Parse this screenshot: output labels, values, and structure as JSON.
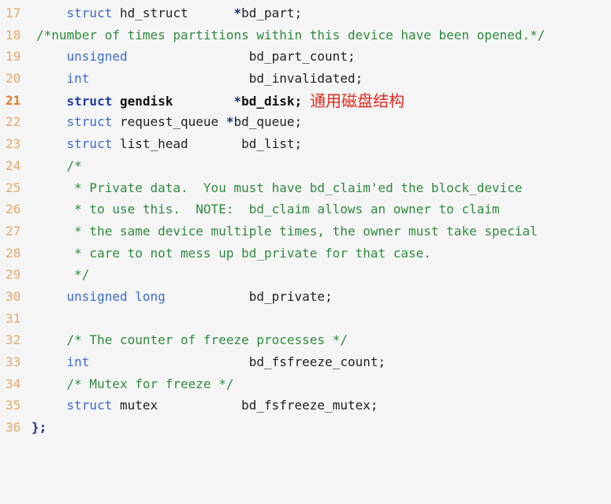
{
  "annotation": "通用磁盘结构",
  "lines": [
    {
      "num": "17"
    },
    {
      "num": "18"
    },
    {
      "num": "19"
    },
    {
      "num": "20"
    },
    {
      "num": "21"
    },
    {
      "num": "22"
    },
    {
      "num": "23"
    },
    {
      "num": "24"
    },
    {
      "num": "25"
    },
    {
      "num": "26"
    },
    {
      "num": "27"
    },
    {
      "num": "28"
    },
    {
      "num": "29"
    },
    {
      "num": "30"
    },
    {
      "num": "31"
    },
    {
      "num": "32"
    },
    {
      "num": "33"
    },
    {
      "num": "34"
    },
    {
      "num": "35"
    },
    {
      "num": "36"
    }
  ],
  "tokens": {
    "l17_kw": "struct",
    "l17_type": " hd_struct",
    "l17_star": "*",
    "l17_field": "bd_part;",
    "l18_comment": "/*number of times partitions within this device have been opened.*/",
    "l19_kw": "unsigned",
    "l19_field": "bd_part_count;",
    "l20_kw": "int",
    "l20_field": "bd_invalidated;",
    "l21_kw": "struct",
    "l21_type": " gendisk",
    "l21_star": "*",
    "l21_field": "bd_disk;",
    "l22_kw": "struct",
    "l22_type": " request_queue ",
    "l22_star": "*",
    "l22_field": "bd_queue;",
    "l23_kw": "struct",
    "l23_type": " list_head",
    "l23_field": "bd_list;",
    "l24_comment": "/*",
    "l25_comment": " * Private data.  You must have bd_claim'ed the block_device",
    "l26_comment": " * to use this.  NOTE:  bd_claim allows an owner to claim",
    "l27_comment": " * the same device multiple times, the owner must take special",
    "l28_comment": " * care to not mess up bd_private for that case.",
    "l29_comment": " */",
    "l30_kw": "unsigned long",
    "l30_field": "bd_private;",
    "l32_comment": "/* The counter of freeze processes */",
    "l33_kw": "int",
    "l33_field": "bd_fsfreeze_count;",
    "l34_comment": "/* Mutex for freeze */",
    "l35_kw": "struct",
    "l35_type": " mutex",
    "l35_field": "bd_fsfreeze_mutex;",
    "l36_close": "};"
  }
}
